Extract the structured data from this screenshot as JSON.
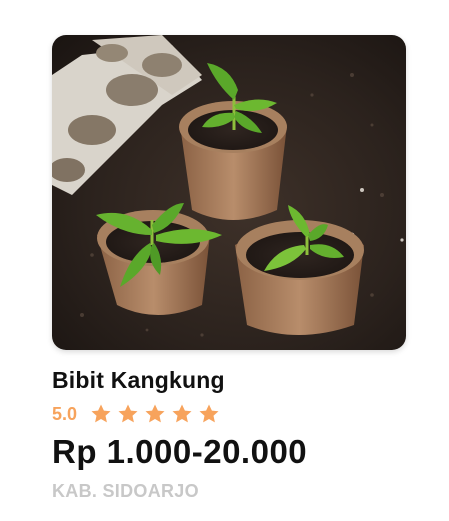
{
  "product": {
    "name": "Bibit Kangkung",
    "rating": "5.0",
    "star_count": 5,
    "price": "Rp 1.000-20.000",
    "location": "KAB. SIDOARJO"
  },
  "colors": {
    "star": "#f7a35c",
    "rating_text": "#f7a35c",
    "location_text": "#c8c8c8",
    "title_text": "#111111"
  },
  "icons": {
    "star": "star-icon"
  }
}
